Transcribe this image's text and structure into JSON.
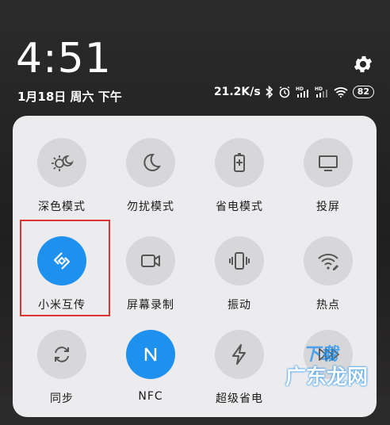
{
  "statusbar": {
    "time": "4:51",
    "date": "1月18日 周六 下午",
    "net_speed": "21.2K/s",
    "battery": "82"
  },
  "tiles": [
    {
      "label": "深色模式",
      "icon": "dark-mode-icon",
      "active": false
    },
    {
      "label": "勿扰模式",
      "icon": "moon-icon",
      "active": false
    },
    {
      "label": "省电模式",
      "icon": "battery-saver-icon",
      "active": false
    },
    {
      "label": "投屏",
      "icon": "screen-cast-icon",
      "active": false
    },
    {
      "label": "小米互传",
      "icon": "mi-share-icon",
      "active": true
    },
    {
      "label": "屏幕录制",
      "icon": "screen-record-icon",
      "active": false
    },
    {
      "label": "振动",
      "icon": "vibrate-icon",
      "active": false
    },
    {
      "label": "热点",
      "icon": "hotspot-icon",
      "active": false
    },
    {
      "label": "同步",
      "icon": "sync-icon",
      "active": false
    },
    {
      "label": "NFC",
      "icon": "nfc-icon",
      "active": true
    },
    {
      "label": "超级省电",
      "icon": "ultra-saver-icon",
      "active": false
    },
    {
      "label": "",
      "icon": "fast-forward-icon",
      "active": false
    }
  ],
  "watermark": {
    "line1": "下载",
    "line2": "广东龙网"
  },
  "colors": {
    "accent": "#1e90ee",
    "highlight": "#d9362f",
    "panel": "#ececee"
  }
}
